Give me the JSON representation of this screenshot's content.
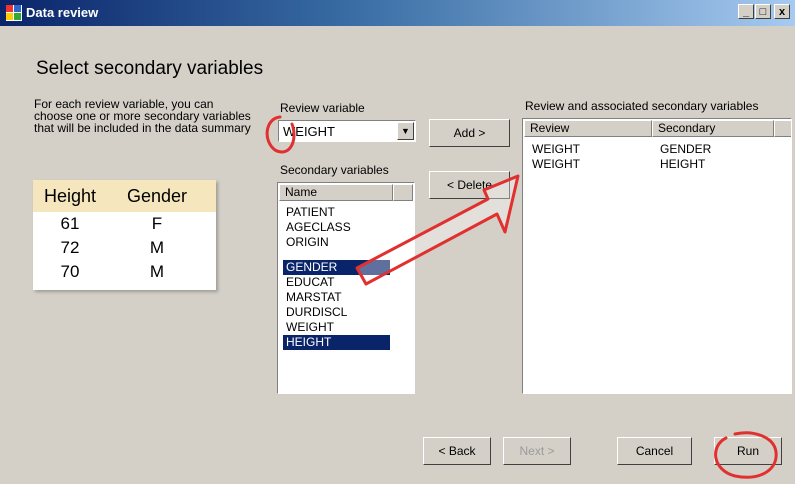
{
  "window": {
    "title": "Data review",
    "min_btn": "_",
    "max_btn": "□",
    "close_btn": "x"
  },
  "heading": "Select secondary variables",
  "description": "For each review variable, you can choose one or more secondary variables that will be included in the data summary",
  "example_table": {
    "headers": [
      "Height",
      "Gender"
    ],
    "rows": [
      [
        "61",
        "F"
      ],
      [
        "72",
        "M"
      ],
      [
        "70",
        "M"
      ]
    ]
  },
  "review_variable": {
    "label": "Review variable",
    "value": "WEIGHT"
  },
  "secondary": {
    "label": "Secondary variables",
    "column": "Name",
    "items": [
      "PATIENT",
      "AGECLASS",
      "ORIGIN",
      "GENDER",
      "EDUCAT",
      "MARSTAT",
      "DURDISCL",
      "WEIGHT",
      "HEIGHT"
    ],
    "selected": [
      "GENDER",
      "HEIGHT"
    ]
  },
  "buttons": {
    "add": "Add >",
    "delete": "< Delete",
    "back": "< Back",
    "next": "Next >",
    "cancel": "Cancel",
    "run": "Run"
  },
  "associated": {
    "label": "Review and associated secondary variables",
    "columns": [
      "Review",
      "Secondary"
    ],
    "rows": [
      [
        "WEIGHT",
        "GENDER"
      ],
      [
        "WEIGHT",
        "HEIGHT"
      ]
    ]
  },
  "colors": {
    "selection": "#0a246a",
    "annotation": "#e03030",
    "table_header": "#f5e6be"
  },
  "icons": {
    "app": "app-icon",
    "dropdown": "chevron-down-icon"
  }
}
